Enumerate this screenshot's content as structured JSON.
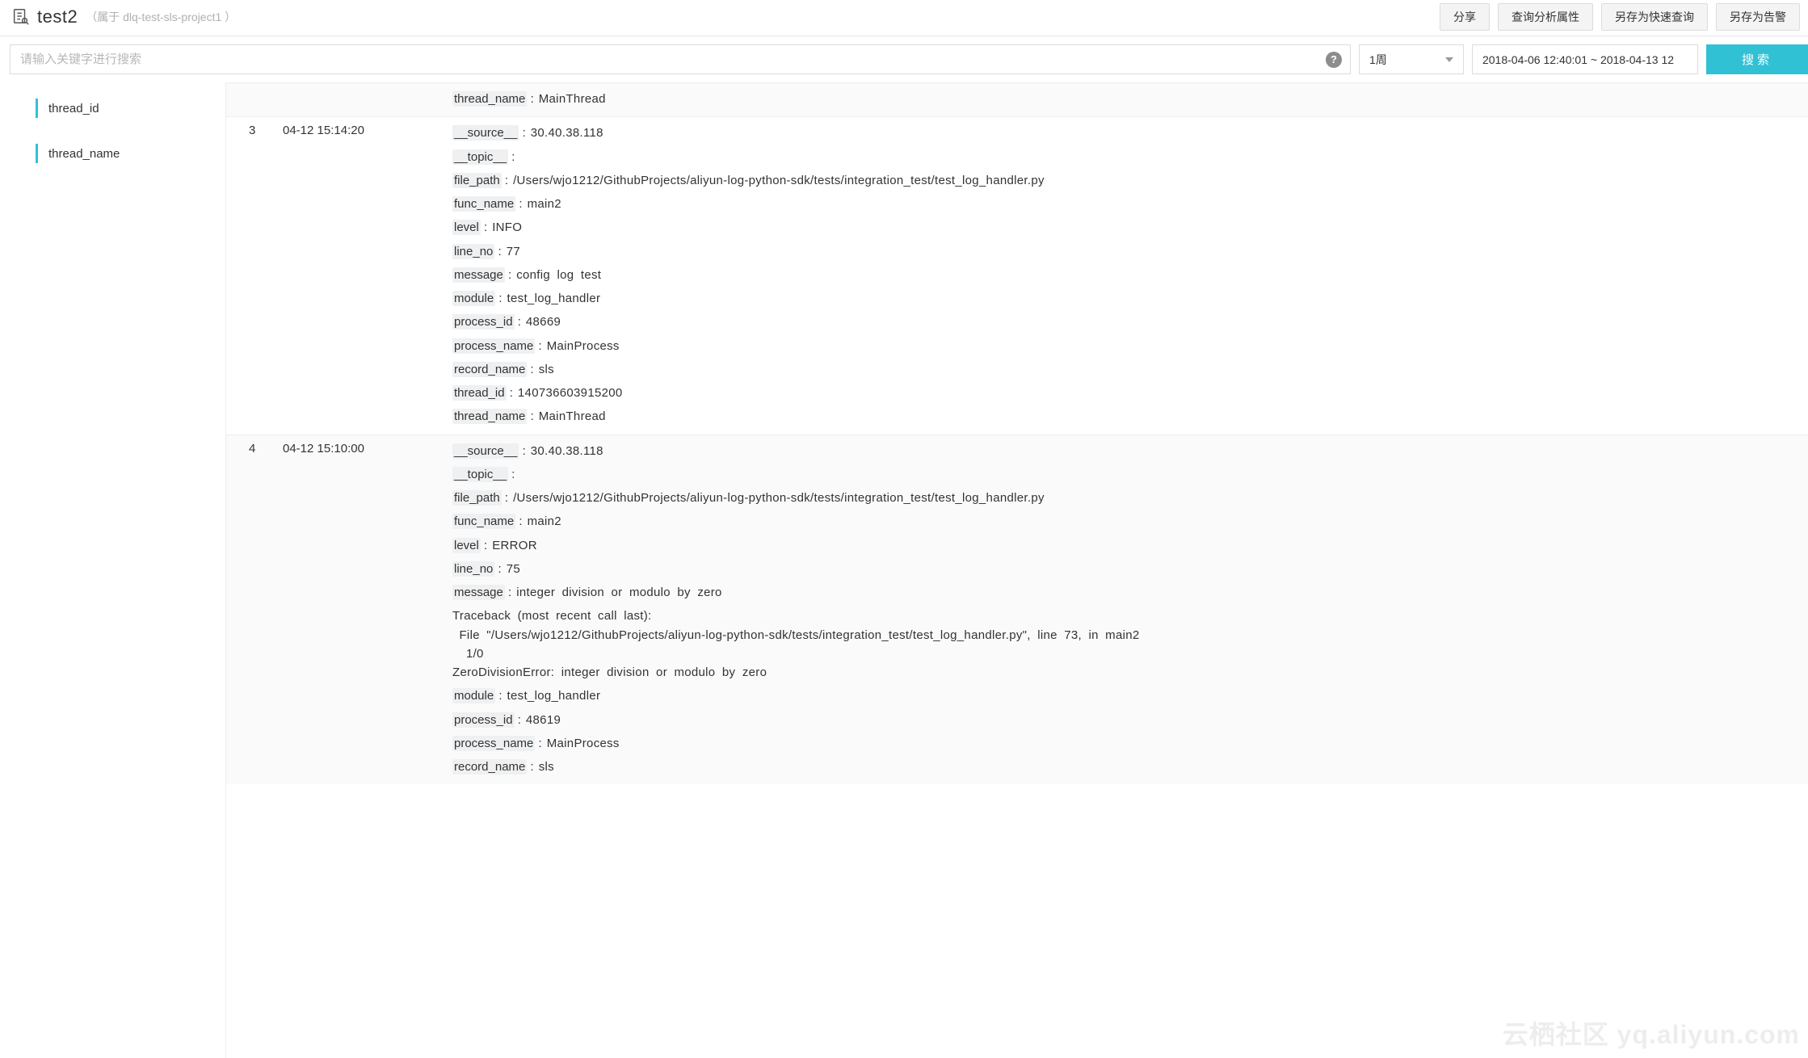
{
  "header": {
    "title": "test2",
    "subtitle": "（属于 dlq-test-sls-project1 ）",
    "buttons": {
      "share": "分享",
      "query_attrs": "查询分析属性",
      "save_quick": "另存为快速查询",
      "save_alert": "另存为告警"
    }
  },
  "search": {
    "placeholder": "请输入关键字进行搜索",
    "range_label": "1周",
    "time_range": "2018-04-06 12:40:01 ~ 2018-04-13 12",
    "search_label": "搜索"
  },
  "sidebar": {
    "items": [
      {
        "label": "thread_id"
      },
      {
        "label": "thread_name"
      }
    ]
  },
  "logs": [
    {
      "idx": "",
      "time": "",
      "fields": [
        {
          "k": "thread_name",
          "v": "MainThread"
        }
      ]
    },
    {
      "idx": "3",
      "time": "04-12 15:14:20",
      "fields": [
        {
          "k": "__source__",
          "v": "30.40.38.118"
        },
        {
          "k": "__topic__",
          "v": ""
        },
        {
          "k": "file_path",
          "v": "/Users/wjo1212/GithubProjects/aliyun-log-python-sdk/tests/integration_test/test_log_handler.py"
        },
        {
          "k": "func_name",
          "v": "main2"
        },
        {
          "k": "level",
          "v": "INFO"
        },
        {
          "k": "line_no",
          "v": "77"
        },
        {
          "k": "message",
          "v": "config log test"
        },
        {
          "k": "module",
          "v": "test_log_handler"
        },
        {
          "k": "process_id",
          "v": "48669"
        },
        {
          "k": "process_name",
          "v": "MainProcess"
        },
        {
          "k": "record_name",
          "v": "sls"
        },
        {
          "k": "thread_id",
          "v": "140736603915200"
        },
        {
          "k": "thread_name",
          "v": "MainThread"
        }
      ]
    },
    {
      "idx": "4",
      "time": "04-12 15:10:00",
      "fields": [
        {
          "k": "__source__",
          "v": "30.40.38.118"
        },
        {
          "k": "__topic__",
          "v": ""
        },
        {
          "k": "file_path",
          "v": "/Users/wjo1212/GithubProjects/aliyun-log-python-sdk/tests/integration_test/test_log_handler.py"
        },
        {
          "k": "func_name",
          "v": "main2"
        },
        {
          "k": "level",
          "v": "ERROR"
        },
        {
          "k": "line_no",
          "v": "75"
        },
        {
          "k": "message",
          "v": "integer division or modulo by zero",
          "extra": "Traceback (most recent call last):\n File \"/Users/wjo1212/GithubProjects/aliyun-log-python-sdk/tests/integration_test/test_log_handler.py\", line 73, in main2\n  1/0\nZeroDivisionError: integer division or modulo by zero"
        },
        {
          "k": "module",
          "v": "test_log_handler"
        },
        {
          "k": "process_id",
          "v": "48619"
        },
        {
          "k": "process_name",
          "v": "MainProcess"
        },
        {
          "k": "record_name",
          "v": "sls"
        }
      ]
    }
  ],
  "watermark": "云栖社区 yq.aliyun.com"
}
